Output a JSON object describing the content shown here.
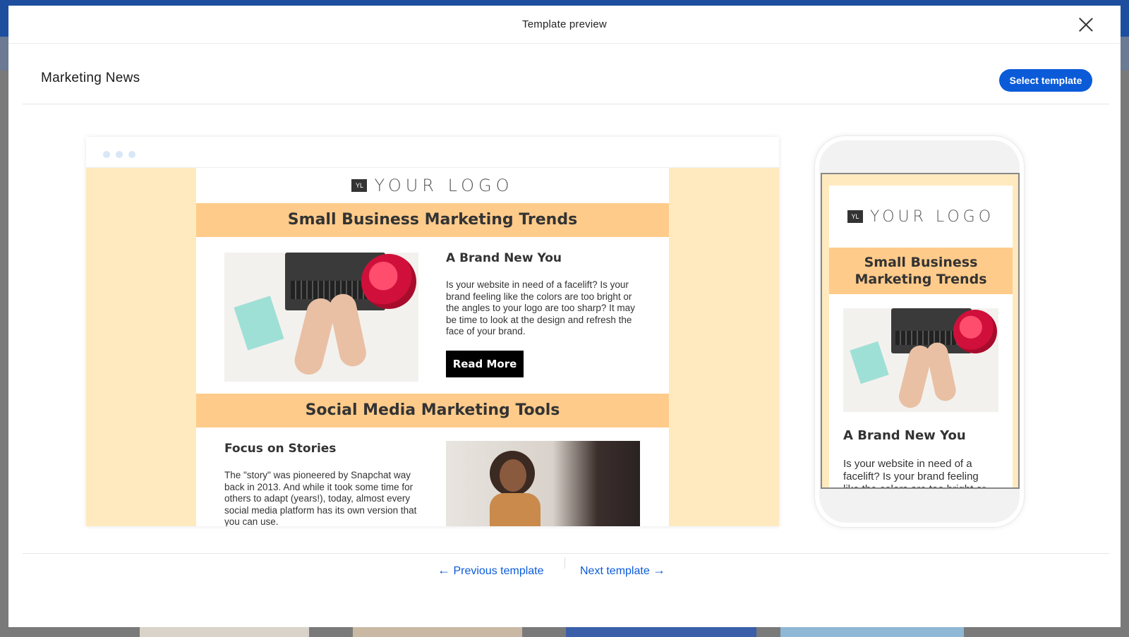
{
  "modal": {
    "title": "Template preview"
  },
  "template": {
    "name": "Marketing News",
    "select_label": "Select template"
  },
  "email_preview": {
    "logo_badge": "YL",
    "logo_text": "YOUR LOGO",
    "section1_title": "Small Business Marketing Trends",
    "article1_title": "A Brand New You",
    "article1_body": "Is your website in need of a facelift? Is your brand feeling like the colors are too bright or the angles to your logo are too sharp? It may be time to look at the design and refresh the face of your brand.",
    "read_more_label": "Read More",
    "section2_title": "Social Media Marketing Tools",
    "article2_title": "Focus on Stories",
    "article2_body": "The \"story\" was pioneered by Snapchat way back in 2013. And while it took some time for others to adapt (years!), today, almost every social media platform has its own version that you can use."
  },
  "mobile_preview": {
    "logo_badge": "YL",
    "logo_text": "YOUR LOGO",
    "section1_title": "Small Business Marketing Trends",
    "article1_title": "A Brand New You",
    "article1_body": "Is your website in need of a facelift? Is your brand feeling like the colors are too bright or the angles to your logo are too sharp?"
  },
  "navigation": {
    "previous_label": "Previous template",
    "next_label": "Next template",
    "previous_icon": "arrow-left-icon",
    "next_icon": "arrow-right-icon"
  },
  "colors": {
    "accent": "#0b5bd9",
    "band": "#ffcb8b",
    "canvas": "#ffeabf"
  }
}
